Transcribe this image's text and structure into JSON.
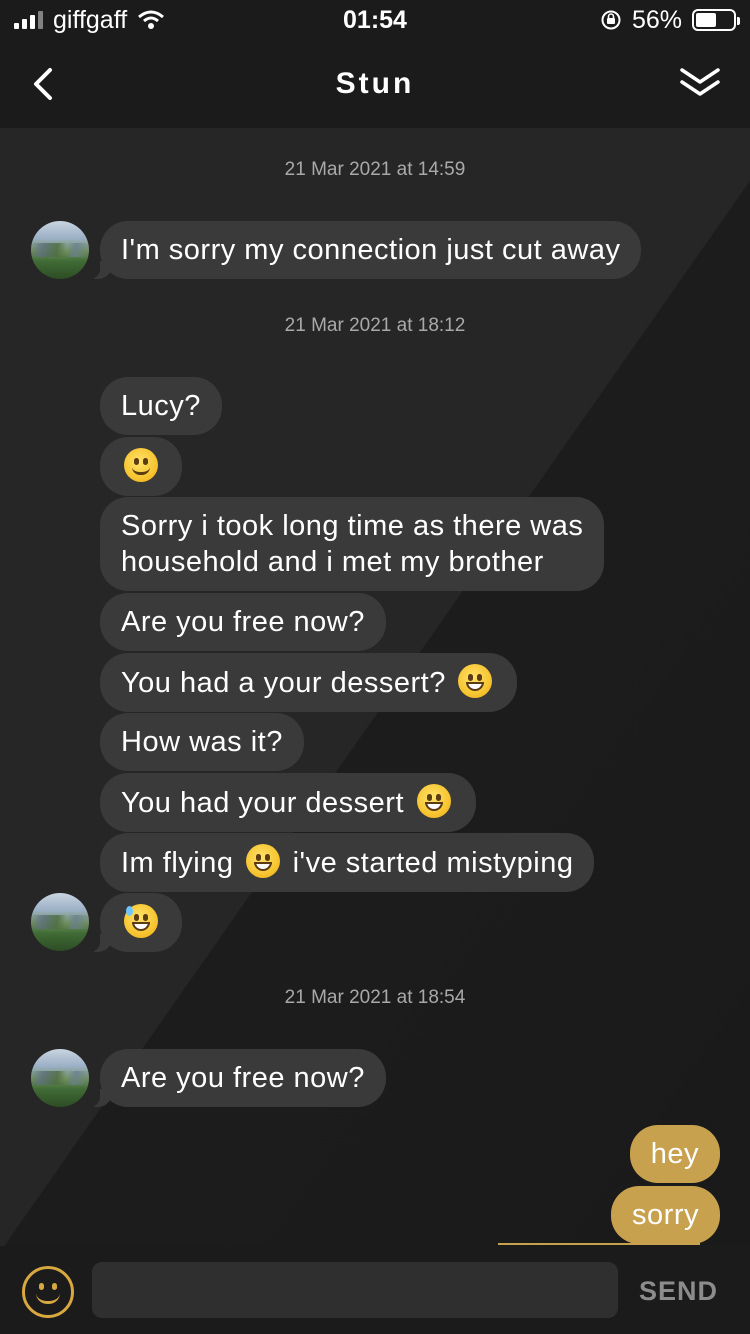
{
  "status_bar": {
    "carrier": "giffgaff",
    "time": "01:54",
    "battery": "56%",
    "battery_level": 0.56
  },
  "nav": {
    "title": "Stun"
  },
  "messages": {
    "timestamps": [
      "21 Mar 2021 at 14:59",
      "21 Mar 2021 at 18:12",
      "21 Mar 2021 at 18:54"
    ],
    "m1": "I'm sorry my connection just cut away",
    "m2": "Lucy?",
    "m4_line1": "Sorry i took long time as there was",
    "m4_line2": "household and i met my brother",
    "m5": "Are you free now?",
    "m6": "You had a your dessert?",
    "m7": "How was it?",
    "m8": "You had your dessert",
    "m9_a": "Im flying",
    "m9_b": "i've started mistyping",
    "m11": "Are you free now?",
    "out1": "hey",
    "out2": "sorry"
  },
  "composer": {
    "placeholder": "",
    "send_label": "SEND"
  },
  "colors": {
    "accent": "#c8a14e",
    "incoming_bubble": "#3a3a3a",
    "background": "#1b1b1b"
  }
}
